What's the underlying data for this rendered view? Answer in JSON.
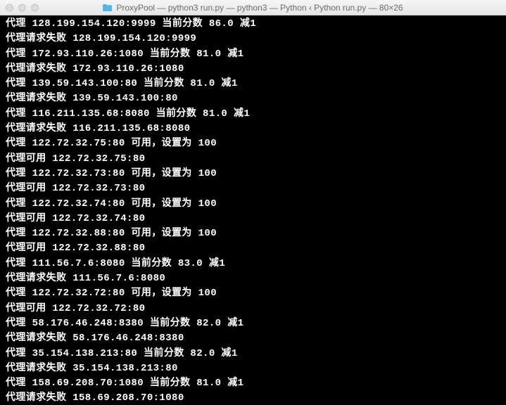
{
  "window": {
    "title": "ProxyPool — python3 run.py — python3 — Python ‹ Python run.py — 80×26"
  },
  "lines": [
    "代理 128.199.154.120:9999 当前分数 86.0 减1",
    "代理请求失败 128.199.154.120:9999",
    "代理 172.93.110.26:1080 当前分数 81.0 减1",
    "代理请求失败 172.93.110.26:1080",
    "代理 139.59.143.100:80 当前分数 81.0 减1",
    "代理请求失败 139.59.143.100:80",
    "代理 116.211.135.68:8080 当前分数 81.0 减1",
    "代理请求失败 116.211.135.68:8080",
    "代理 122.72.32.75:80 可用，设置为 100",
    "代理可用 122.72.32.75:80",
    "代理 122.72.32.73:80 可用，设置为 100",
    "代理可用 122.72.32.73:80",
    "代理 122.72.32.74:80 可用，设置为 100",
    "代理可用 122.72.32.74:80",
    "代理 122.72.32.88:80 可用，设置为 100",
    "代理可用 122.72.32.88:80",
    "代理 111.56.7.6:8080 当前分数 83.0 减1",
    "代理请求失败 111.56.7.6:8080",
    "代理 122.72.32.72:80 可用，设置为 100",
    "代理可用 122.72.32.72:80",
    "代理 58.176.46.248:8380 当前分数 82.0 减1",
    "代理请求失败 58.176.46.248:8380",
    "代理 35.154.138.213:80 当前分数 82.0 减1",
    "代理请求失败 35.154.138.213:80",
    "代理 158.69.208.70:1080 当前分数 81.0 减1",
    "代理请求失败 158.69.208.70:1080"
  ]
}
